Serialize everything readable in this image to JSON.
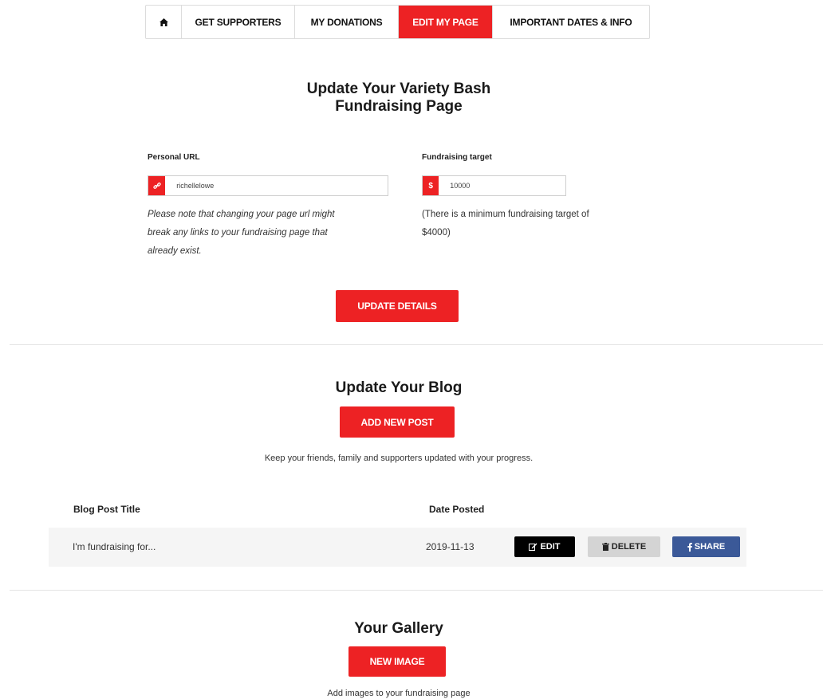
{
  "nav": {
    "home_icon": "home-icon",
    "items": [
      {
        "label": "GET SUPPORTERS"
      },
      {
        "label": "MY DONATIONS"
      },
      {
        "label": "EDIT MY PAGE"
      },
      {
        "label": "IMPORTANT DATES & INFO"
      }
    ],
    "active_color": "#ed2224"
  },
  "page_section": {
    "title_line1": "Update Your Variety Bash",
    "title_line2": "Fundraising Page",
    "personal_url": {
      "label": "Personal URL",
      "icon": "link-icon",
      "value": "richellelowe",
      "note": [
        "Please note that changing your page url might",
        "break any links to your fundraising page that",
        "already exist."
      ]
    },
    "target": {
      "label": "Fundraising target",
      "prefix": "$",
      "value": "10000",
      "note": [
        "(There is a minimum fundraising target of",
        "$4000)"
      ]
    },
    "update_button": "UPDATE DETAILS"
  },
  "blog": {
    "title": "Update Your Blog",
    "add_button": "ADD NEW POST",
    "subtext": "Keep your friends, family and supporters updated with your progress.",
    "columns": [
      "Blog Post Title",
      "Date Posted"
    ],
    "rows": [
      {
        "title": "I'm fundraising for...",
        "date": "2019-11-13"
      }
    ],
    "actions": {
      "edit": "EDIT",
      "delete": "DELETE",
      "share": "SHARE"
    }
  },
  "gallery": {
    "title": "Your Gallery",
    "new_button": "NEW IMAGE",
    "subtext": "Add images to your fundraising page"
  },
  "colors": {
    "brand_red": "#ed2224",
    "facebook_blue": "#3b5998"
  }
}
